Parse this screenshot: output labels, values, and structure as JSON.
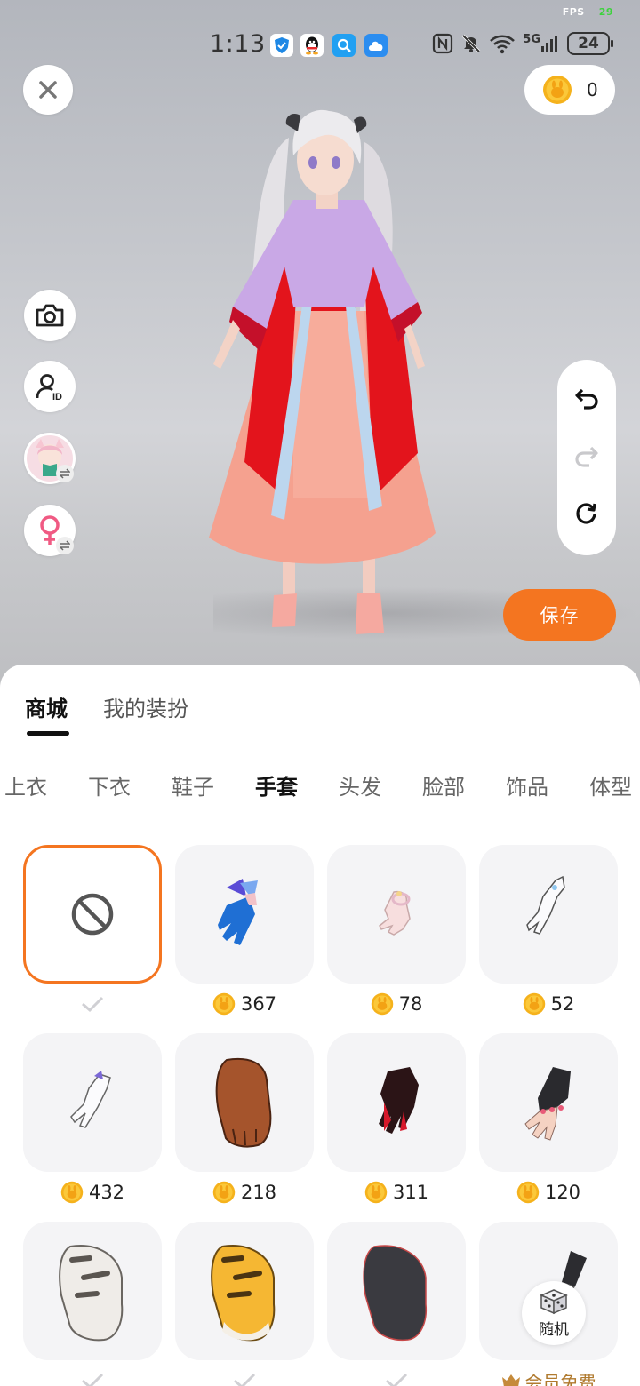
{
  "status_bar": {
    "fps_label": "FPS",
    "fps_value": "29",
    "time": "1:13",
    "network": "5G",
    "battery": "24"
  },
  "coins": {
    "balance": "0"
  },
  "actions": {
    "save_label": "保存"
  },
  "sheet": {
    "top_tabs": [
      "商城",
      "我的装扮"
    ],
    "active_top_tab": 0,
    "categories": [
      "上衣",
      "下衣",
      "鞋子",
      "手套",
      "头发",
      "脸部",
      "饰品",
      "体型"
    ],
    "active_category": 3
  },
  "items": [
    {
      "name": "none",
      "price": null,
      "owned": true,
      "selected": true
    },
    {
      "name": "blue-butterfly-glove",
      "price": "367"
    },
    {
      "name": "pink-lace-glove",
      "price": "78"
    },
    {
      "name": "white-cat-glove",
      "price": "52"
    },
    {
      "name": "white-bow-glove",
      "price": "432"
    },
    {
      "name": "brown-paw-glove",
      "price": "218"
    },
    {
      "name": "red-black-claw-glove",
      "price": "311"
    },
    {
      "name": "black-fingerless-glove",
      "price": "120"
    },
    {
      "name": "white-tiger-paw-glove",
      "price": null,
      "owned": true
    },
    {
      "name": "yellow-tiger-paw-glove",
      "price": null,
      "owned": true
    },
    {
      "name": "black-paw-glove",
      "price": null,
      "owned": true
    },
    {
      "name": "black-gauntlet",
      "price": null,
      "vip_label": "会员免费"
    }
  ],
  "random": {
    "label": "随机"
  },
  "colors": {
    "accent": "#f47520",
    "coin": "#f5b21c",
    "card_bg": "#f4f4f6"
  }
}
